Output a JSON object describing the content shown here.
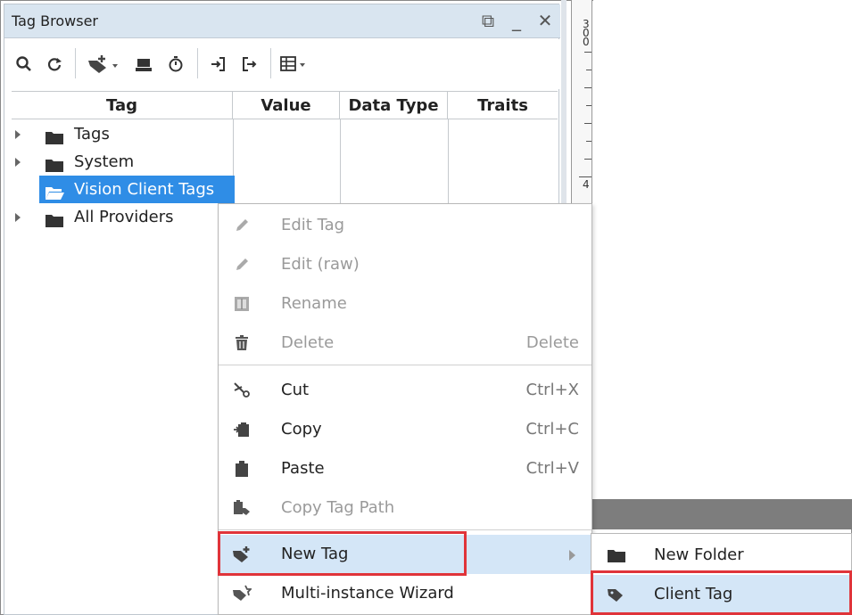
{
  "panel": {
    "title": "Tag Browser",
    "window_buttons": {
      "restore": "⧉",
      "minimize": "_",
      "close": "✕"
    }
  },
  "toolbar": {
    "icons": [
      "search-icon",
      "refresh-icon",
      "add-tag-dropdown-icon",
      "drive-icon",
      "history-icon",
      "import-icon",
      "export-icon",
      "table-view-dropdown-icon"
    ]
  },
  "table": {
    "columns": [
      "Tag",
      "Value",
      "Data Type",
      "Traits"
    ]
  },
  "tree": [
    {
      "label": "Tags",
      "expandable": true,
      "selected": false
    },
    {
      "label": "System",
      "expandable": true,
      "selected": false
    },
    {
      "label": "Vision Client Tags",
      "expandable": false,
      "selected": true
    },
    {
      "label": "All Providers",
      "expandable": true,
      "selected": false
    }
  ],
  "ruler": {
    "labels": [
      "3\n0\n0",
      "4"
    ]
  },
  "context_menu": {
    "items": [
      {
        "label": "Edit Tag",
        "shortcut": "",
        "disabled": true,
        "icon": "pencil-icon"
      },
      {
        "label": "Edit (raw)",
        "shortcut": "",
        "disabled": true,
        "icon": "pencil-icon"
      },
      {
        "label": "Rename",
        "shortcut": "",
        "disabled": true,
        "icon": "rename-icon"
      },
      {
        "label": "Delete",
        "shortcut": "Delete",
        "disabled": true,
        "icon": "trash-icon"
      },
      {
        "label": "Cut",
        "shortcut": "Ctrl+X",
        "disabled": false,
        "icon": "scissors-icon"
      },
      {
        "label": "Copy",
        "shortcut": "Ctrl+C",
        "disabled": false,
        "icon": "copy-icon"
      },
      {
        "label": "Paste",
        "shortcut": "Ctrl+V",
        "disabled": false,
        "icon": "paste-icon"
      },
      {
        "label": "Copy Tag Path",
        "shortcut": "",
        "disabled": true,
        "icon": "copy-path-icon"
      },
      {
        "label": "New Tag",
        "shortcut": "",
        "disabled": false,
        "icon": "new-tag-icon",
        "has_submenu": true,
        "highlighted": true
      },
      {
        "label": "Multi-instance Wizard",
        "shortcut": "",
        "disabled": false,
        "icon": "wizard-icon"
      }
    ]
  },
  "submenu": {
    "items": [
      {
        "label": "New Folder",
        "icon": "folder-icon",
        "highlighted": false
      },
      {
        "label": "Client Tag",
        "icon": "tag-icon",
        "highlighted": true
      }
    ]
  },
  "colors": {
    "selection": "#2f8de6",
    "menu_hover": "#d4e6f7",
    "highlight_box": "#e0343a",
    "titlebar": "#d9e5f0"
  }
}
